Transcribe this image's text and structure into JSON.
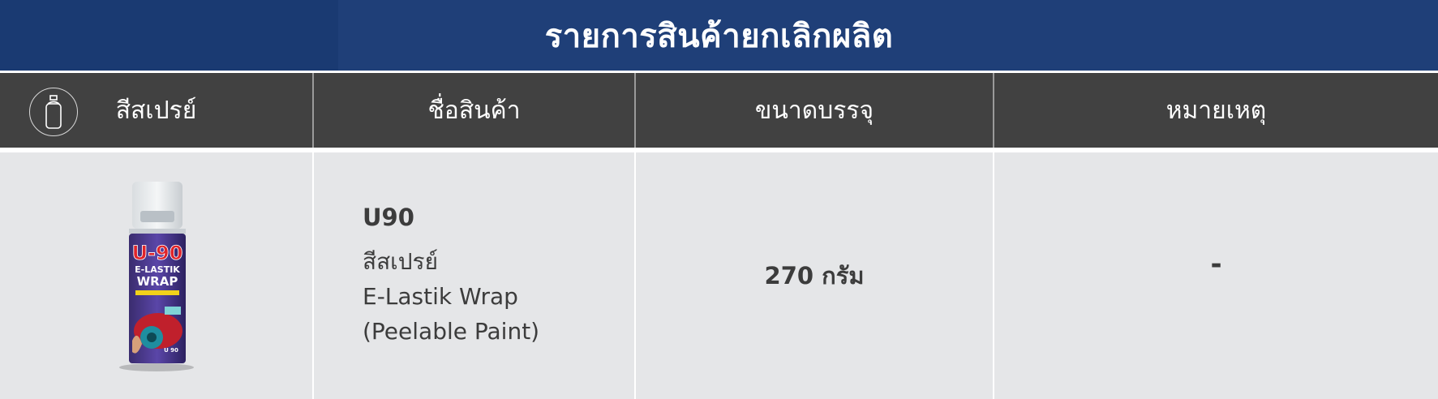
{
  "title": "รายการสินค้ายกเลิกผลิต",
  "columns": [
    {
      "label": "สีสเปรย์",
      "icon": "spray-can-icon"
    },
    {
      "label": "ชื่อสินค้า"
    },
    {
      "label": "ขนาดบรรจุ"
    },
    {
      "label": "หมายเหตุ"
    }
  ],
  "rows": [
    {
      "image_icon": "spray-can-product-image",
      "can_brand": "U-90",
      "can_label_top": "E-LASTIK",
      "can_label_bottom": "WRAP",
      "can_code": "U 90",
      "code": "U90",
      "name_lines": [
        "สีสเปรย์",
        "E-Lastik Wrap",
        "(Peelable Paint)"
      ],
      "size": "270 กรัม",
      "note": "-"
    }
  ],
  "colors": {
    "title_bg": "#1f3f78",
    "header_bg": "#414141",
    "row_bg": "#e5e6e8",
    "text": "#3c3c3c"
  }
}
